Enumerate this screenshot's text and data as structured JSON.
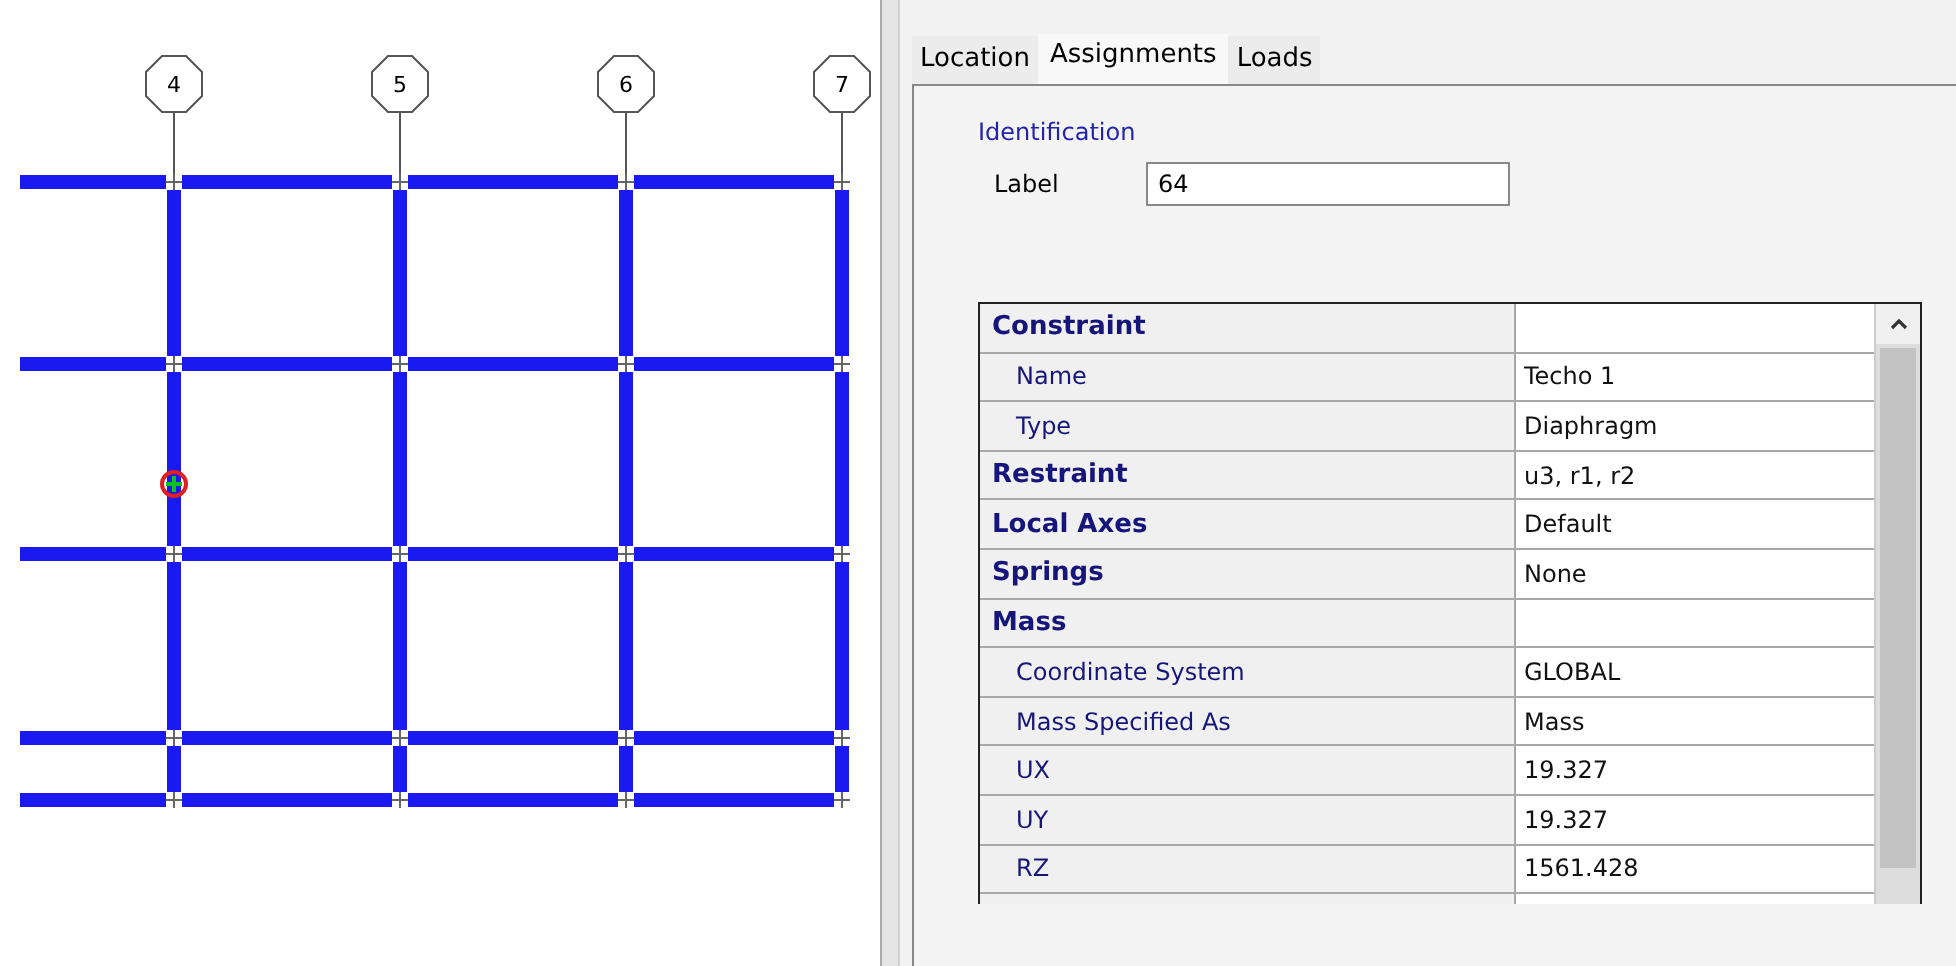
{
  "model_view": {
    "grid_lines": [
      {
        "label": "4"
      },
      {
        "label": "5"
      },
      {
        "label": "6"
      },
      {
        "label": "7"
      }
    ]
  },
  "tabs": [
    {
      "label": "Location",
      "selected": false
    },
    {
      "label": "Assignments",
      "selected": true
    },
    {
      "label": "Loads",
      "selected": false
    }
  ],
  "identification": {
    "title": "Identification",
    "label_caption": "Label",
    "label_value": "64"
  },
  "properties": [
    {
      "name": "Constraint",
      "children": [
        {
          "name": "Name",
          "value": "Techo 1"
        },
        {
          "name": "Type",
          "value": "Diaphragm"
        }
      ]
    },
    {
      "name": "Restraint",
      "value": "u3, r1, r2"
    },
    {
      "name": "Local Axes",
      "value": "Default"
    },
    {
      "name": "Springs",
      "value": "None"
    },
    {
      "name": "Mass",
      "children": [
        {
          "name": "Coordinate System",
          "value": "GLOBAL"
        },
        {
          "name": "Mass Specified As",
          "value": "Mass"
        },
        {
          "name": "UX",
          "value": "19.327"
        },
        {
          "name": "UY",
          "value": "19.327"
        },
        {
          "name": "RZ",
          "value": "1561.428"
        }
      ]
    }
  ]
}
